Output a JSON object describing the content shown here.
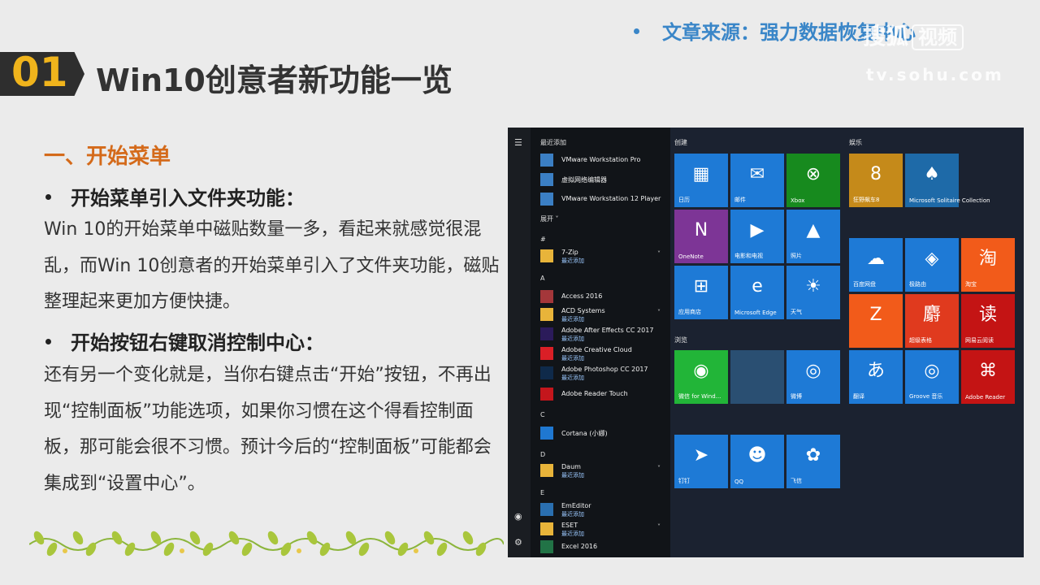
{
  "header": {
    "source_text": "文章来源：强力数据恢复中心",
    "watermark_name": "搜狐",
    "watermark_box": "视频",
    "watermark_url": "tv.sohu.com",
    "section_number": "01",
    "title": "Win10创意者新功能一览"
  },
  "content": {
    "section_title": "一、开始菜单",
    "bullet1": "开始菜单引入文件夹功能：",
    "para1": "Win 10的开始菜单中磁贴数量一多，看起来就感觉很混乱，而Win 10创意者的开始菜单引入了文件夹功能，磁贴整理起来更加方便快捷。",
    "bullet2": "开始按钮右键取消控制中心：",
    "para2": "还有另一个变化就是，当你右键点击“开始”按钮，不再出现“控制面板”功能选项，如果你习惯在这个得看控制面板，那可能会很不习惯。预计今后的“控制面板”可能都会集成到“设置中心”。"
  },
  "startmenu": {
    "recent_header": "最近添加",
    "expand_label": "展开 ˅",
    "recent": [
      {
        "name": "VMware Workstation Pro",
        "color": "#3b7fc4"
      },
      {
        "name": "虚拟网络编辑器",
        "color": "#3b7fc4"
      },
      {
        "name": "VMware Workstation 12 Player",
        "color": "#3b7fc4"
      }
    ],
    "letters": [
      "#",
      "A",
      "C",
      "D",
      "E"
    ],
    "apps": [
      {
        "name": "7-Zip",
        "sub": "最近添加",
        "color": "#e8b43a",
        "chev": "˅"
      },
      {
        "name": "Access 2016",
        "sub": "",
        "color": "#a4373a",
        "chev": ""
      },
      {
        "name": "ACD Systems",
        "sub": "最近添加",
        "color": "#e8b43a",
        "chev": "˅"
      },
      {
        "name": "Adobe After Effects CC 2017",
        "sub": "最近添加",
        "color": "#2b1b5a",
        "chev": ""
      },
      {
        "name": "Adobe Creative Cloud",
        "sub": "最近添加",
        "color": "#da1f26",
        "chev": ""
      },
      {
        "name": "Adobe Photoshop CC 2017",
        "sub": "最近添加",
        "color": "#0f2a4a",
        "chev": ""
      },
      {
        "name": "Adobe Reader Touch",
        "sub": "",
        "color": "#c4161c",
        "chev": ""
      },
      {
        "name": "Cortana (小娜)",
        "sub": "",
        "color": "#1f78d1",
        "chev": ""
      },
      {
        "name": "Daum",
        "sub": "最近添加",
        "color": "#e8b43a",
        "chev": "˅"
      },
      {
        "name": "EmEditor",
        "sub": "最近添加",
        "color": "#2a6fb0",
        "chev": ""
      },
      {
        "name": "ESET",
        "sub": "最近添加",
        "color": "#e8b43a",
        "chev": "˅"
      },
      {
        "name": "Excel 2016",
        "sub": "",
        "color": "#217346",
        "chev": ""
      }
    ],
    "group_create": "创建",
    "group_browse": "浏览",
    "group_play": "娱乐",
    "tiles_create": [
      {
        "label": "日历",
        "icon": "▦",
        "color": "#1e7ad6"
      },
      {
        "label": "邮件",
        "icon": "✉",
        "color": "#1e7ad6"
      },
      {
        "label": "Xbox",
        "icon": "⊗",
        "color": "#178a1e"
      },
      {
        "label": "OneNote",
        "icon": "N",
        "color": "#7d3596"
      },
      {
        "label": "电影和电视",
        "icon": "▶",
        "color": "#1e7ad6"
      },
      {
        "label": "照片",
        "icon": "▲",
        "color": "#1e7ad6"
      },
      {
        "label": "应用商店",
        "icon": "⊞",
        "color": "#1e7ad6"
      },
      {
        "label": "Microsoft Edge",
        "icon": "e",
        "color": "#1e7ad6"
      },
      {
        "label": "天气",
        "icon": "☀",
        "color": "#1e7ad6"
      }
    ],
    "tiles_browse": [
      {
        "label": "微信 for Wind...",
        "icon": "◉",
        "color": "#22b538"
      },
      {
        "label": "",
        "icon": "",
        "color": "#2a4f72"
      },
      {
        "label": "微博",
        "icon": "◎",
        "color": "#1e7ad6"
      },
      {
        "label": "钉钉",
        "icon": "➤",
        "color": "#1e7ad6"
      },
      {
        "label": "QQ",
        "icon": "☻",
        "color": "#1e7ad6"
      },
      {
        "label": "飞信",
        "icon": "✿",
        "color": "#1e7ad6"
      }
    ],
    "tiles_play_top": [
      {
        "label": "狂野飙车8",
        "icon": "8",
        "color": "#c58a1a"
      },
      {
        "label": "Microsoft Solitaire Collection",
        "icon": "♠",
        "color": "#1e6aa8"
      }
    ],
    "tiles_play": [
      {
        "label": "百度网盘",
        "icon": "☁",
        "color": "#1e7ad6"
      },
      {
        "label": "极路由",
        "icon": "◈",
        "color": "#1e7ad6"
      },
      {
        "label": "淘宝",
        "icon": "淘",
        "color": "#f25b1a"
      },
      {
        "label": "",
        "icon": "Z",
        "color": "#f25b1a"
      },
      {
        "label": "超级表格",
        "icon": "麝",
        "color": "#e03a1e"
      },
      {
        "label": "网易云阅读",
        "icon": "读",
        "color": "#c41414"
      },
      {
        "label": "翻译",
        "icon": "あ",
        "color": "#1e7ad6"
      },
      {
        "label": "Groove 音乐",
        "icon": "◎",
        "color": "#1e7ad6"
      },
      {
        "label": "Adobe Reader",
        "icon": "⌘",
        "color": "#c41414"
      }
    ],
    "rail_icons": [
      "hamburger-icon",
      "user-icon",
      "settings-icon"
    ]
  }
}
